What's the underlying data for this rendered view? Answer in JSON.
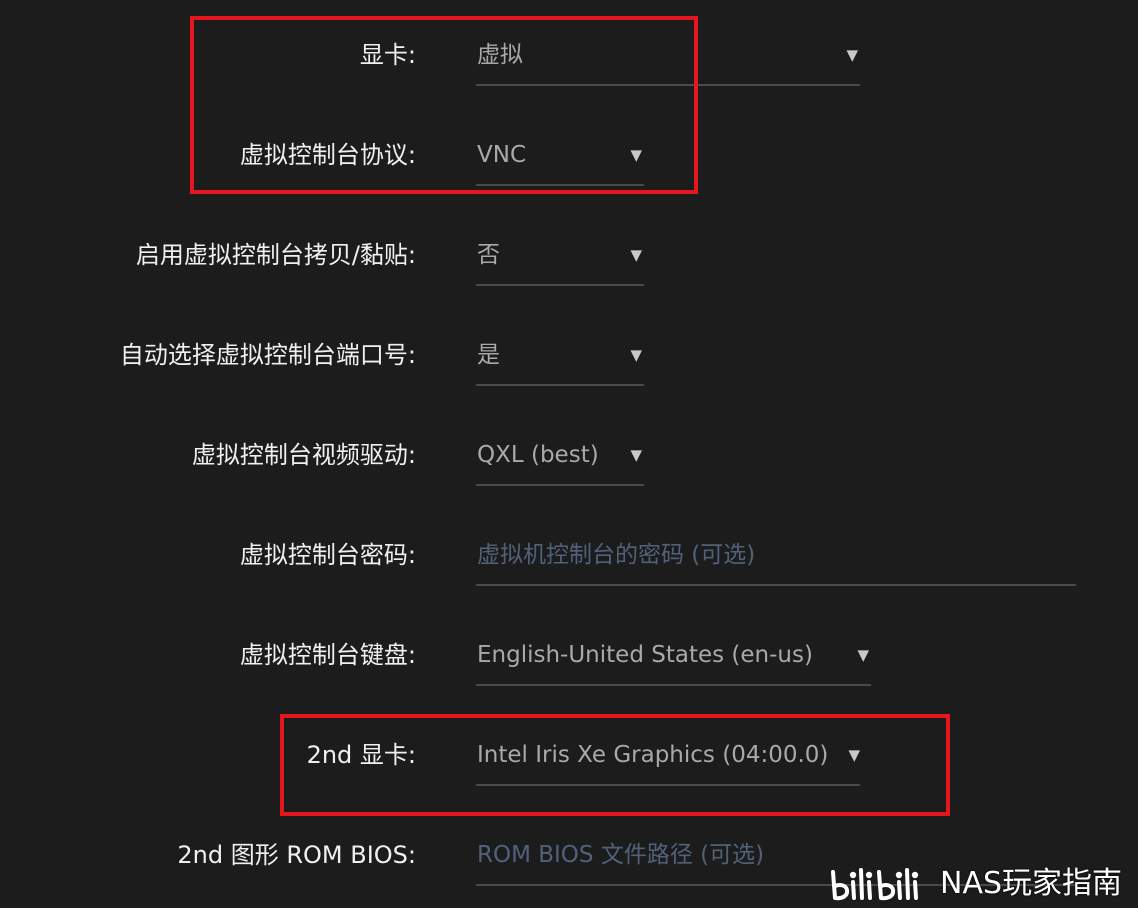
{
  "form": {
    "rows": [
      {
        "label": "显卡:",
        "value": "虚拟",
        "caret": "▼"
      },
      {
        "label": "虚拟控制台协议:",
        "value": "VNC",
        "caret": "▼"
      },
      {
        "label": "启用虚拟控制台拷贝/黏贴:",
        "value": "否",
        "caret": "▼"
      },
      {
        "label": "自动选择虚拟控制台端口号:",
        "value": "是",
        "caret": "▼"
      },
      {
        "label": "虚拟控制台视频驱动:",
        "value": "QXL (best)",
        "caret": "▼"
      },
      {
        "label": "虚拟控制台密码:",
        "placeholder": "虚拟机控制台的密码 (可选)"
      },
      {
        "label": "虚拟控制台键盘:",
        "value": "English-United States (en-us)",
        "caret": "▼"
      },
      {
        "label": "2nd 显卡:",
        "value": "Intel Iris Xe Graphics (04:00.0)",
        "caret": "▼"
      },
      {
        "label": "2nd 图形 ROM BIOS:",
        "placeholder": "ROM BIOS 文件路径 (可选)"
      }
    ]
  },
  "watermark": {
    "logo": "bilibili",
    "text": "NAS玩家指南"
  },
  "colors": {
    "background": "#1c1c1c",
    "label": "#f0f0f0",
    "value": "#a9a9a9",
    "placeholder": "#52617a",
    "underline": "#4a4a4a",
    "highlight": "#e5161c"
  }
}
